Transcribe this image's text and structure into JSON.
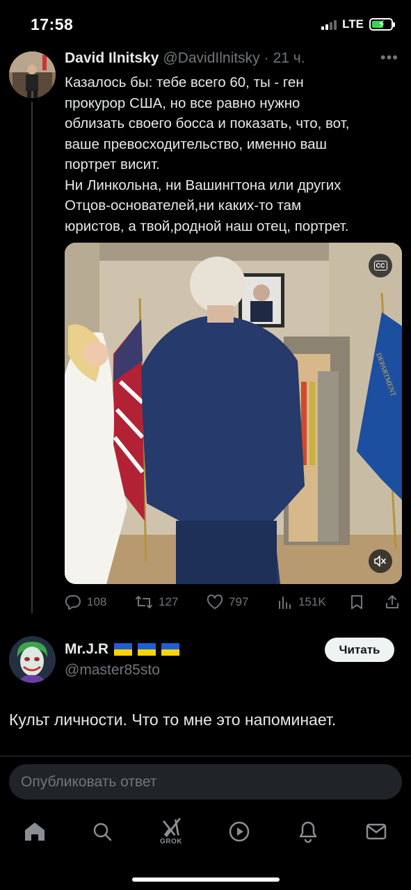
{
  "status_bar": {
    "time": "17:58",
    "network": "LTE",
    "battery_level": 0.6,
    "battery_color": "#32d74b"
  },
  "tweet": {
    "author_name": "David Ilnitsky",
    "handle": "@DavidIlnitsky",
    "separator": "·",
    "time": "21 ч.",
    "more_icon": "ellipsis-icon",
    "text_lines": [
      "Казалось бы: тебе всего 60, ты - ген",
      "прокурор США, но все равно нужно",
      "облизать своего босса и показать, что, вот,",
      "ваше превосходительство, именно ваш",
      "портрет висит.",
      "Ни Линкольна, ни Вашингтона или других",
      "Отцов-основателей,ни каких-то там",
      "юристов, а твой,родной наш отец, портрет."
    ],
    "media": {
      "cc_label": "CC",
      "flag_text": "DEPARTMENT"
    },
    "stats": {
      "replies": "108",
      "reposts": "127",
      "likes": "797",
      "views": "151K"
    }
  },
  "reply": {
    "author_name": "Mr.J.R",
    "flags_count": 3,
    "handle": "@master85sto",
    "follow_label": "Читать",
    "text": "Культ личности. Что то мне это напоминает."
  },
  "compose": {
    "placeholder": "Опубликовать ответ"
  },
  "tabbar": {
    "items": [
      "home-icon",
      "search-icon",
      "grok-icon",
      "video-icon",
      "notifications-icon",
      "messages-icon"
    ],
    "grok_label": "GROK"
  },
  "colors": {
    "background": "#000000",
    "text_primary": "#e7e9ea",
    "text_secondary": "#71767b",
    "divider": "#2f3336"
  }
}
